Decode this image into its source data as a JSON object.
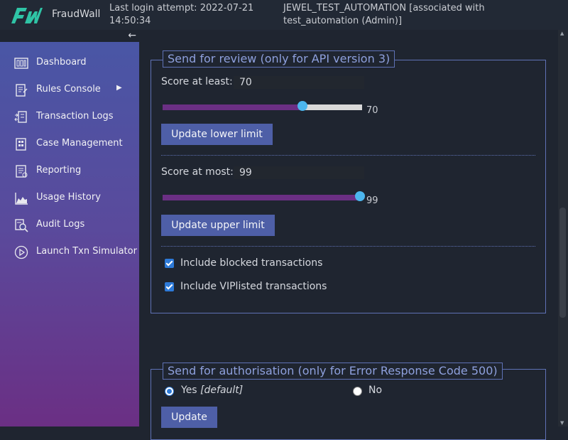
{
  "header": {
    "brand": "FraudWall",
    "last_login": "Last login attempt: 2022-07-21 14:50:34",
    "user_info": "JEWEL_TEST_AUTOMATION [associated with test_automation (Admin)]"
  },
  "sidebar": {
    "items": [
      {
        "label": "Dashboard",
        "icon": "dashboard-icon"
      },
      {
        "label": "Rules Console",
        "icon": "rules-icon"
      },
      {
        "label": "Transaction Logs",
        "icon": "transaction-icon"
      },
      {
        "label": "Case Management",
        "icon": "case-icon"
      },
      {
        "label": "Reporting",
        "icon": "reporting-icon"
      },
      {
        "label": "Usage History",
        "icon": "usage-chart-icon"
      },
      {
        "label": "Audit Logs",
        "icon": "audit-search-icon"
      },
      {
        "label": "Launch Txn Simulator",
        "icon": "play-circle-icon"
      }
    ]
  },
  "review": {
    "legend": "Send for review (only for API version 3)",
    "lower_label": "Score at least:",
    "lower_value": "70",
    "lower_slider_value": "70",
    "lower_fraction": 0.7,
    "lower_button": "Update lower limit",
    "upper_label": "Score at most:",
    "upper_value": "99",
    "upper_slider_value": "99",
    "upper_fraction": 0.99,
    "upper_button": "Update upper limit",
    "include_blocked": "Include blocked transactions",
    "include_vip": "Include VIPlisted transactions"
  },
  "authorisation": {
    "legend": "Send for authorisation (only for Error Response Code 500)",
    "yes_label": "Yes",
    "yes_default": "[default]",
    "no_label": "No",
    "update_button": "Update"
  },
  "colors": {
    "accent": "#4e5fa7",
    "slider_fill": "#6b2f84",
    "slider_thumb": "#4cb6ee",
    "legend_text": "#8ea0dd"
  }
}
